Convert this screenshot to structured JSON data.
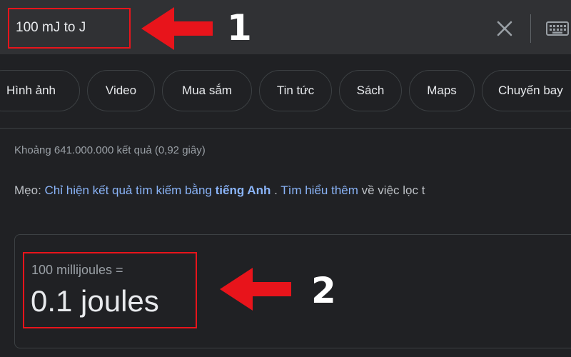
{
  "search": {
    "query": "100 mJ to J"
  },
  "icons": {
    "clear": "close-icon",
    "keyboard": "keyboard-icon",
    "annotation_arrow": "arrow-left-icon"
  },
  "chips": [
    {
      "label": "Hình ảnh"
    },
    {
      "label": "Video"
    },
    {
      "label": "Mua sắm"
    },
    {
      "label": "Tin tức"
    },
    {
      "label": "Sách"
    },
    {
      "label": "Maps"
    },
    {
      "label": "Chuyến bay"
    }
  ],
  "results": {
    "stats": "Khoảng 641.000.000 kết quả (0,92 giây)",
    "tip": {
      "prefix": "Mẹo: ",
      "link1": "Chỉ hiện kết quả tìm kiếm bằng ",
      "link1_bold": "tiếng Anh",
      "sep": " . ",
      "link2": "Tìm hiểu thêm",
      "suffix": " về việc lọc t"
    }
  },
  "converter": {
    "from": "100 millijoules =",
    "result": "0.1 joules"
  },
  "annotations": {
    "label1": "1",
    "label2": "2"
  },
  "colors": {
    "background": "#202124",
    "search_bar": "#303134",
    "link": "#8ab4f8",
    "annotation": "#e8141b"
  }
}
